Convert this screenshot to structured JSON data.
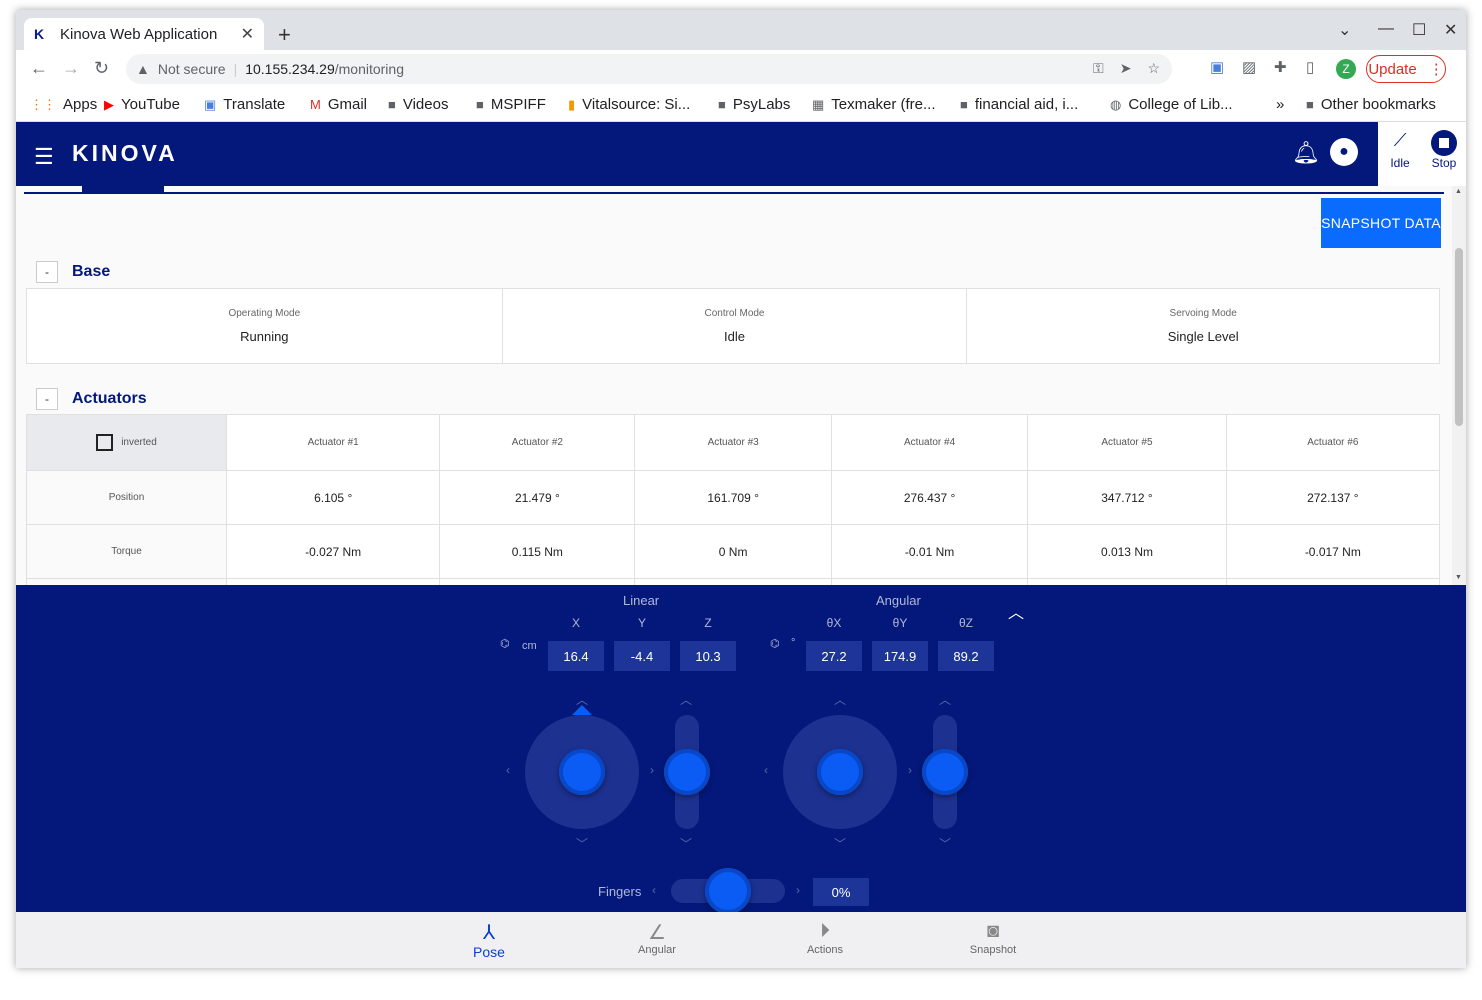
{
  "browser": {
    "tab_title": "Kinova Web Application",
    "not_secure": "Not secure",
    "url_host": "10.155.234.29",
    "url_path": "/monitoring",
    "update_label": "Update",
    "profile_letter": "Z",
    "bookmarks": [
      "Apps",
      "YouTube",
      "Translate",
      "Gmail",
      "Videos",
      "MSPIFF",
      "Vitalsource: Si...",
      "PsyLabs",
      "Texmaker (fre...",
      "financial aid, i...",
      "College of Lib...",
      "Other bookmarks"
    ]
  },
  "app": {
    "logo": "KINOVA",
    "idle_label": "Idle",
    "stop_label": "Stop",
    "snapshot_button": "SNAPSHOT DATA",
    "accent_color": "#03187a",
    "button_color": "#0a6cff"
  },
  "base": {
    "title": "Base",
    "toggle": "-",
    "cells": [
      {
        "label": "Operating Mode",
        "value": "Running"
      },
      {
        "label": "Control Mode",
        "value": "Idle"
      },
      {
        "label": "Servoing Mode",
        "value": "Single Level"
      }
    ]
  },
  "actuators": {
    "title": "Actuators",
    "toggle": "-",
    "inverted_label": "inverted",
    "headers": [
      "Actuator #1",
      "Actuator #2",
      "Actuator #3",
      "Actuator #4",
      "Actuator #5",
      "Actuator #6"
    ],
    "rows": [
      {
        "label": "Position",
        "values": [
          "6.105 °",
          "21.479 °",
          "161.709 °",
          "276.437 °",
          "347.712 °",
          "272.137 °"
        ]
      },
      {
        "label": "Torque",
        "values": [
          "-0.027 Nm",
          "0.115 Nm",
          "0 Nm",
          "-0.01 Nm",
          "0.013 Nm",
          "-0.017 Nm"
        ]
      }
    ]
  },
  "control": {
    "linear_label": "Linear",
    "angular_label": "Angular",
    "linear_unit": "cm",
    "angular_unit": "°",
    "linear_axes": [
      {
        "axis": "X",
        "value": "16.4"
      },
      {
        "axis": "Y",
        "value": "-4.4"
      },
      {
        "axis": "Z",
        "value": "10.3"
      }
    ],
    "angular_axes": [
      {
        "axis": "θX",
        "value": "27.2"
      },
      {
        "axis": "θY",
        "value": "174.9"
      },
      {
        "axis": "θZ",
        "value": "89.2"
      }
    ],
    "fingers_label": "Fingers",
    "fingers_value": "0%"
  },
  "bottom_nav": [
    {
      "label": "Pose",
      "icon": "pose-icon"
    },
    {
      "label": "Angular",
      "icon": "angle-icon"
    },
    {
      "label": "Actions",
      "icon": "play-icon"
    },
    {
      "label": "Snapshot",
      "icon": "camera-icon"
    }
  ]
}
